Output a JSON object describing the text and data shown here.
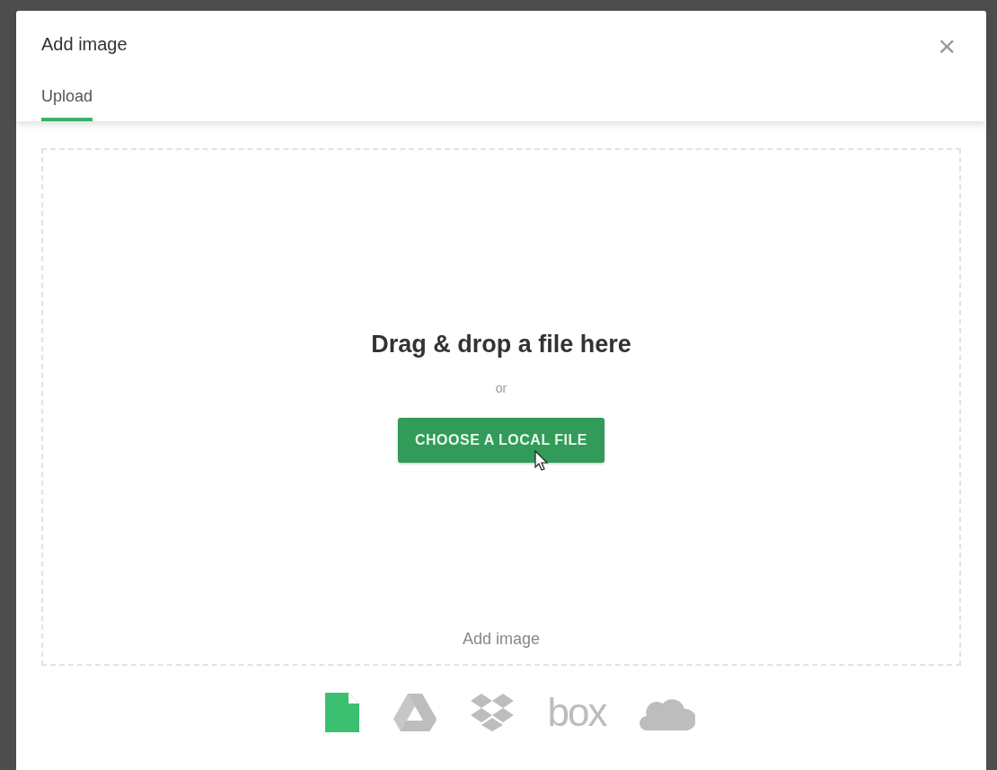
{
  "dialog": {
    "title": "Add image",
    "close": "×"
  },
  "tabs": [
    {
      "label": "Upload",
      "selected": true
    }
  ],
  "dropzone": {
    "heading": "Drag & drop a file here",
    "separator": "or",
    "button": "CHOOSE A LOCAL FILE",
    "caption": "Add image"
  },
  "sources": [
    {
      "kind": "file",
      "selected": true
    },
    {
      "kind": "drive",
      "selected": false
    },
    {
      "kind": "dropbox",
      "selected": false
    },
    {
      "kind": "box",
      "label": "box",
      "selected": false
    },
    {
      "kind": "cloud",
      "selected": false
    }
  ]
}
